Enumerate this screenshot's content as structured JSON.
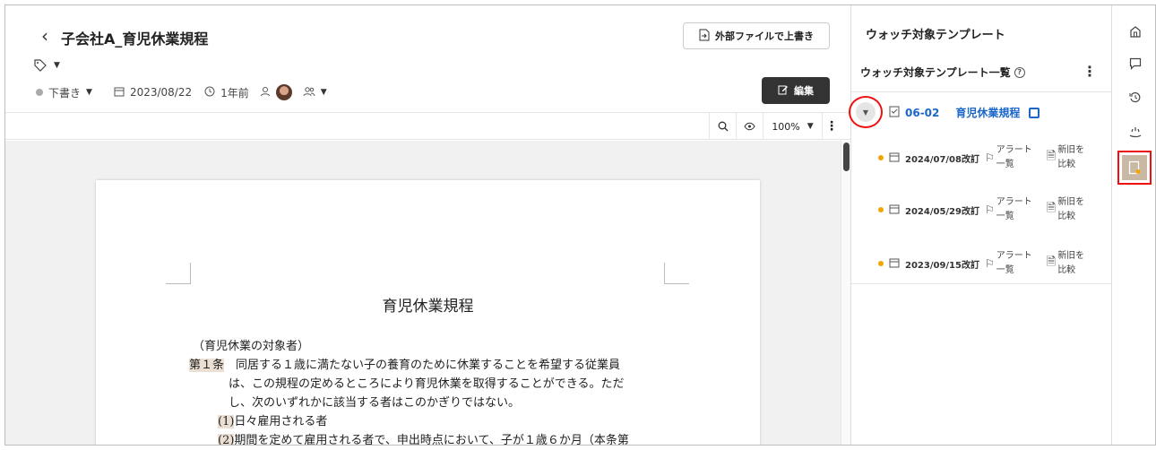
{
  "header": {
    "title": "子会社A_育児休業規程",
    "status": "下書き",
    "date": "2023/08/22",
    "relative_time": "1年前",
    "external_file_button": "外部ファイルで上書き",
    "edit_button": "編集"
  },
  "toolbar": {
    "zoom": "100%"
  },
  "document": {
    "title": "育児休業規程",
    "section_heading": "（育児休業の対象者）",
    "article_label": "第１条",
    "article_line1": "　同居する１歳に満たない子の養育のために休業することを希望する従業員",
    "article_line2": "は、この規程の定めるところにより育児休業を取得することができる。ただ",
    "article_line3": "し、次のいずれかに該当する者はこのかぎりではない。",
    "item1_num": "(1)",
    "item1_text": "日々雇用される者",
    "item2_num": "(2)",
    "item2_text": "期間を定めて雇用される者で、申出時点において、子が１歳６か月（本条第"
  },
  "panel": {
    "title": "ウォッチ対象テンプレート",
    "list_title": "ウォッチ対象テンプレート一覧",
    "template_code": "06-02",
    "template_name": "育児休業規程",
    "revisions": [
      {
        "date": "2024/07/08改訂",
        "alert_line1": "アラート",
        "alert_line2": "一覧",
        "compare_line1": "新旧を",
        "compare_line2": "比較"
      },
      {
        "date": "2024/05/29改訂",
        "alert_line1": "アラート",
        "alert_line2": "一覧",
        "compare_line1": "新旧を",
        "compare_line2": "比較"
      },
      {
        "date": "2023/09/15改訂",
        "alert_line1": "アラート",
        "alert_line2": "一覧",
        "compare_line1": "新旧を",
        "compare_line2": "比較"
      }
    ]
  },
  "colors": {
    "accent_blue": "#1a66c9",
    "highlight_red": "#ee1111",
    "revision_dot": "#f0a500",
    "edit_button_bg": "#333333",
    "article_highlight": "#eadfd2"
  },
  "icons": [
    "back-icon",
    "tag-icon",
    "calendar-icon",
    "clock-icon",
    "person-icon",
    "group-icon",
    "file-import-icon",
    "edit-icon",
    "search-icon",
    "eye-icon",
    "kebab-icon",
    "help-icon",
    "chevron-down-icon",
    "checklist-icon",
    "copy-icon",
    "flag-icon",
    "compare-icon",
    "home-icon",
    "comment-icon",
    "history-icon",
    "sparkle-icon",
    "watch-template-icon"
  ]
}
